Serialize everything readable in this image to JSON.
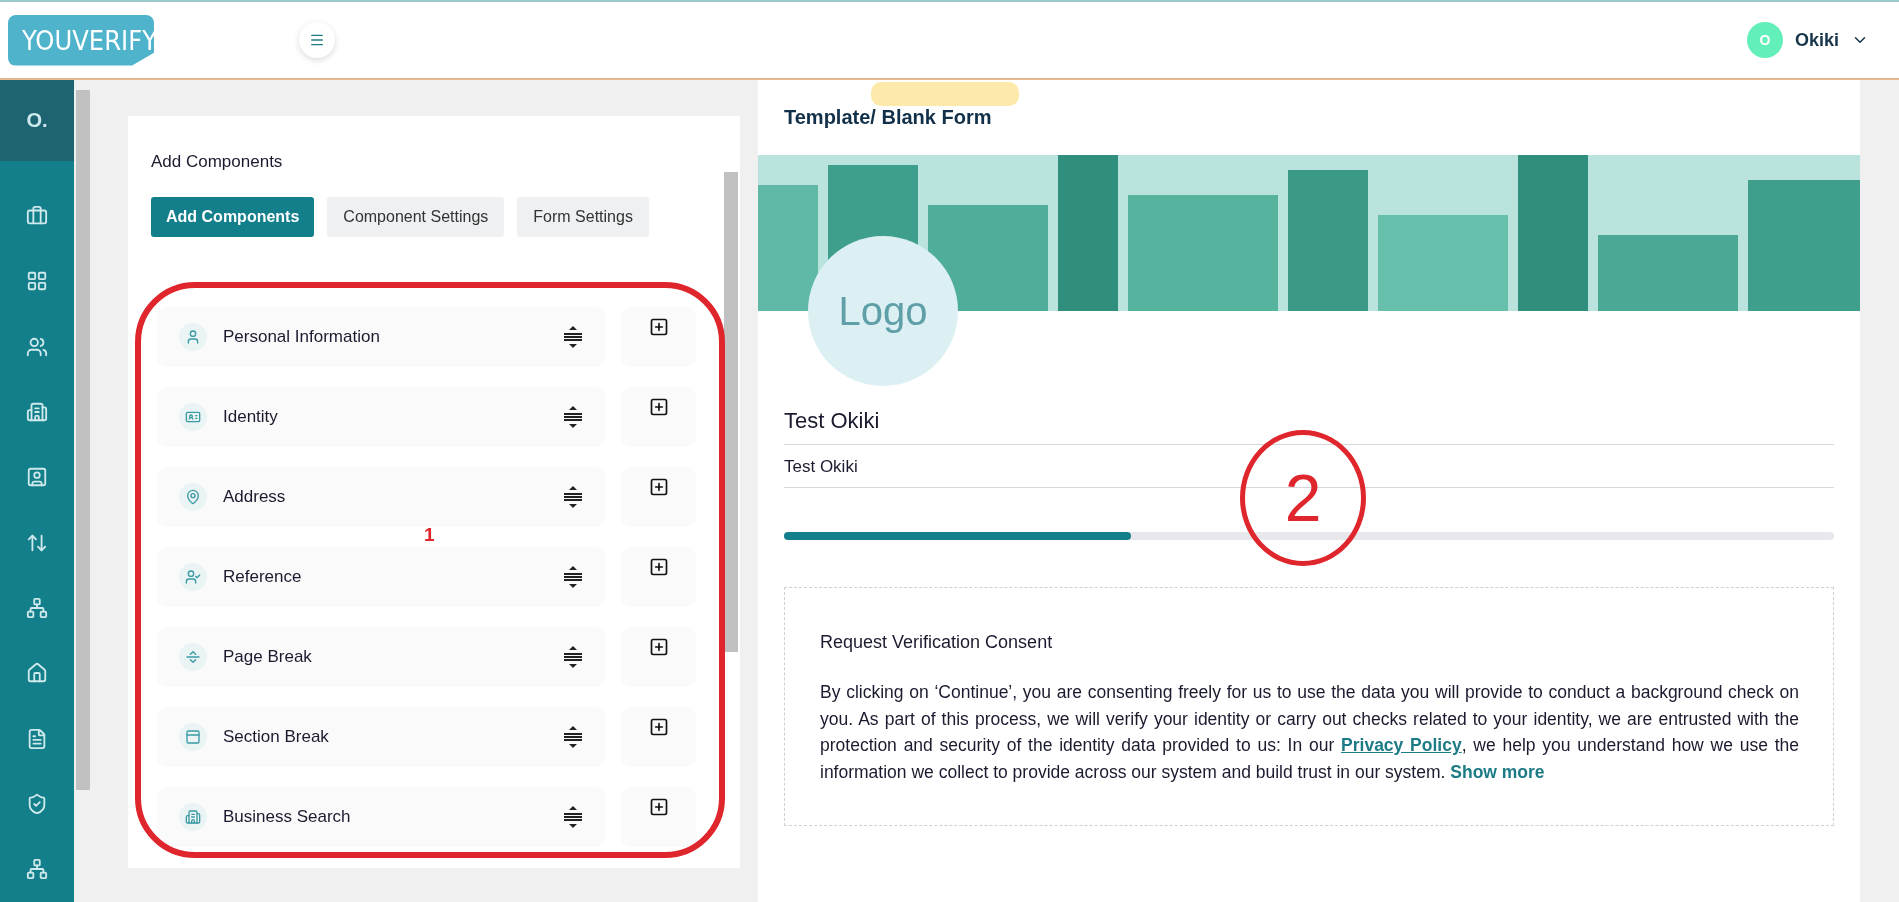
{
  "header": {
    "logo": "YOUVERIFY",
    "user": {
      "initial": "O",
      "name": "Okiki"
    }
  },
  "sidebar": {
    "badge": "O."
  },
  "builder": {
    "title": "Add Components",
    "tabs": [
      {
        "label": "Add Components",
        "selected": true
      },
      {
        "label": "Component Settings",
        "selected": false
      },
      {
        "label": "Form Settings",
        "selected": false
      }
    ],
    "components": [
      {
        "label": "Personal Information",
        "kind": "person"
      },
      {
        "label": "Identity",
        "kind": "id-card"
      },
      {
        "label": "Address",
        "kind": "location"
      },
      {
        "label": "Reference",
        "kind": "reference"
      },
      {
        "label": "Page Break",
        "kind": "page-break"
      },
      {
        "label": "Section Break",
        "kind": "section-break"
      },
      {
        "label": "Business Search",
        "kind": "business"
      }
    ]
  },
  "form": {
    "title": "Template/ Blank Form",
    "logo": "Logo",
    "name": "Test Okiki",
    "field": {
      "value": "Test Okiki"
    },
    "progress": {
      "level": 0.33
    },
    "consent": {
      "title": "Request Verification Consent",
      "text_before": "By clicking on ‘Continue’, you are consenting freely for us to use the data you will provide to conduct a background check on you. As part of this process, we will verify your identity or carry out checks related to your identity, we are entrusted with the protection and security of the identity data provided to us: In our ",
      "link": "Privacy Policy",
      "text_after": ", we help you understand how we use the information we collect to provide across our system and build trust in our system. ",
      "more": "Show more"
    }
  },
  "annotations": [
    {
      "kind": "box",
      "label": "1"
    },
    {
      "kind": "circle",
      "label": "2"
    }
  ]
}
